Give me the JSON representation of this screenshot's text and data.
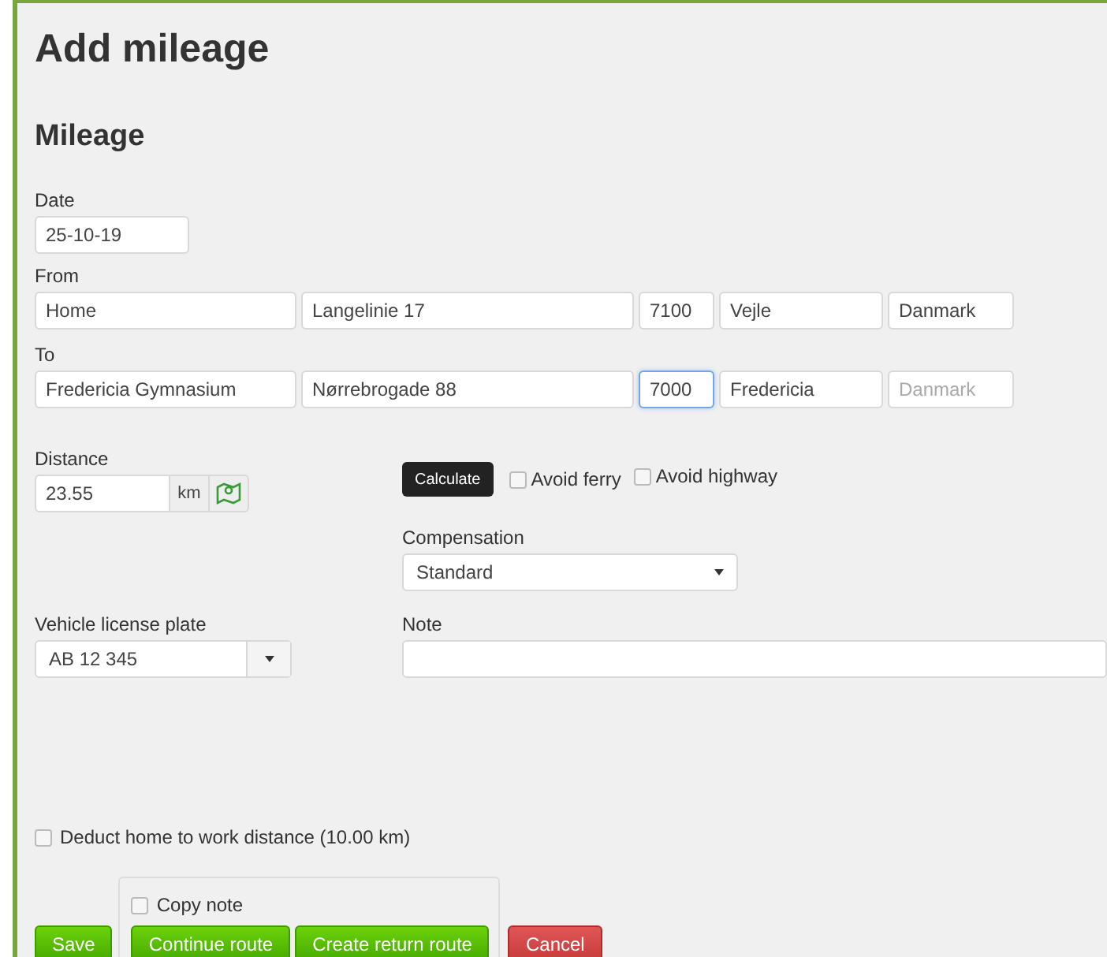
{
  "page_title": "Add mileage",
  "section_title": "Mileage",
  "date": {
    "label": "Date",
    "value": "25-10-19"
  },
  "from": {
    "label": "From",
    "fields": [
      {
        "value": "Home"
      },
      {
        "value": "Langelinie 17"
      },
      {
        "value": "7100"
      },
      {
        "value": "Vejle"
      },
      {
        "value": "Danmark"
      }
    ]
  },
  "to": {
    "label": "To",
    "fields": [
      {
        "value": "Fredericia Gymnasium"
      },
      {
        "value": "Nørrebrogade 88"
      },
      {
        "value": "7000",
        "focused": true
      },
      {
        "value": "Fredericia"
      },
      {
        "placeholder": "Danmark"
      }
    ]
  },
  "distance": {
    "label": "Distance",
    "value": "23.55",
    "unit": "km"
  },
  "calculate_button": "Calculate",
  "route_options": [
    {
      "label": "Avoid ferry",
      "checked": false
    },
    {
      "label": "Avoid highway",
      "checked": false
    }
  ],
  "compensation": {
    "label": "Compensation",
    "value": "Standard"
  },
  "vehicle": {
    "label": "Vehicle license plate",
    "value": "AB 12 345"
  },
  "note": {
    "label": "Note"
  },
  "deduct": {
    "label": "Deduct home to work distance (10.00 km)",
    "checked": false
  },
  "copy_note": {
    "label": "Copy note",
    "checked": false
  },
  "buttons": [
    {
      "label": "Save",
      "kind": "success"
    },
    {
      "label": "Continue route",
      "kind": "success"
    },
    {
      "label": "Create return route",
      "kind": "success"
    },
    {
      "label": "Cancel",
      "kind": "danger"
    }
  ]
}
